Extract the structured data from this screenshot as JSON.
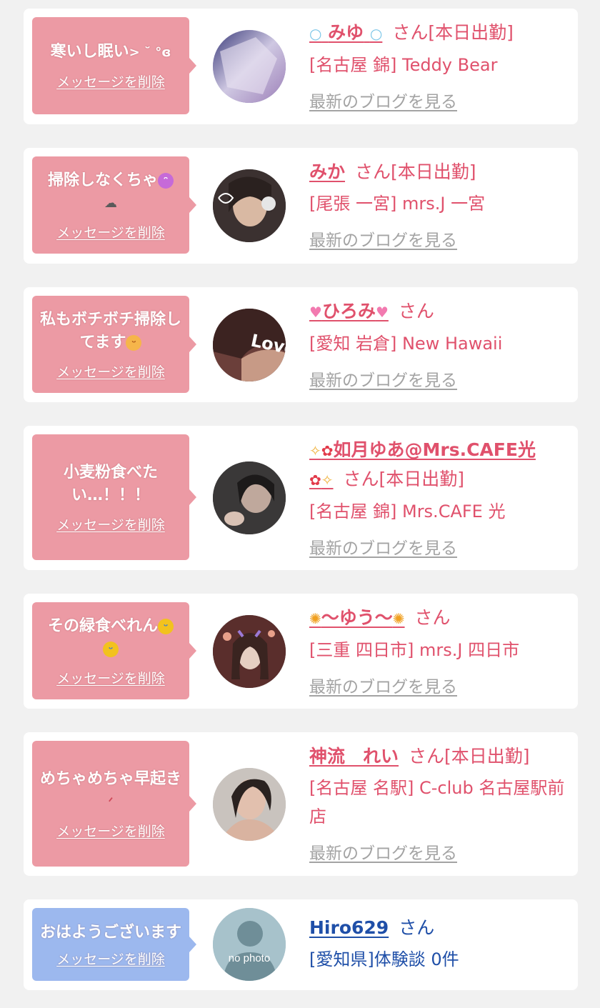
{
  "items": [
    {
      "message": "寒いし眠い",
      "message_suffix": "> ˘ °ɞ",
      "delete_label": "メッセージを削除",
      "name_prefix_icon": "bubbles-icon",
      "name": "みゆ",
      "name_suffix_icon": "bubbles-icon",
      "san": "さん",
      "status": "[本日出勤]",
      "shop": "[名古屋 錦] Teddy Bear",
      "blog_label": "最新のブログを見る"
    },
    {
      "message": "掃除しなくちゃ",
      "message_emoji": "face-with-tongue-icon",
      "message_emoji2": "ear-icon",
      "delete_label": "メッセージを削除",
      "name": "みか",
      "san": "さん",
      "status": "[本日出勤]",
      "shop": "[尾張 一宮] mrs.J 一宮",
      "blog_label": "最新のブログを見る"
    },
    {
      "message": "私もボチボチ掃除してます",
      "message_emoji": "smiling-face-icon",
      "delete_label": "メッセージを削除",
      "name_prefix_icon": "pink-heart-icon",
      "name": "ひろみ",
      "name_suffix_icon": "pink-heart-icon",
      "san": "さん",
      "status": "",
      "shop": "[愛知 岩倉] New Hawaii",
      "blog_label": "最新のブログを見る"
    },
    {
      "message": "小麦粉食べたい…！！！",
      "delete_label": "メッセージを削除",
      "name_prefix_icon": "sparkles-hibiscus-icon",
      "name": "如月ゆあ@Mrs.CAFE光",
      "name_suffix_icon": "hibiscus-sparkles-icon",
      "san": "さん",
      "status": "[本日出勤]",
      "shop": "[名古屋 錦] Mrs.CAFE 光",
      "blog_label": "最新のブログを見る"
    },
    {
      "message": "その緑食べれん",
      "message_emoji": "rolling-laughing-icon",
      "delete_label": "メッセージを削除",
      "name_prefix_icon": "sunflower-icon",
      "name": "〜ゆう〜",
      "name_suffix_icon": "sunflower-icon",
      "san": "さん",
      "status": "",
      "shop": "[三重 四日市] mrs.J 四日市",
      "blog_label": "最新のブログを見る"
    },
    {
      "message": "めちゃめちゃ早起き",
      "message_emoji": "tired-face-icon",
      "delete_label": "メッセージを削除",
      "name": "神流　れい",
      "san": "さん",
      "status": "[本日出勤]",
      "shop": "[名古屋 名駅] C-club 名古屋駅前店",
      "blog_label": "最新のブログを見る"
    },
    {
      "message": "おはようございます",
      "delete_label": "メッセージを削除",
      "name": "Hiro629",
      "san": "さん",
      "status": "",
      "shop": "[愛知県]体験談 0件",
      "avatar_text": "no photo"
    }
  ],
  "colors": {
    "pink_bubble": "#ec9aa4",
    "blue_bubble": "#9cb8ee",
    "pink_text": "#e0516c",
    "blue_text": "#1f4fa8",
    "link_gray": "#a3a3a3"
  }
}
